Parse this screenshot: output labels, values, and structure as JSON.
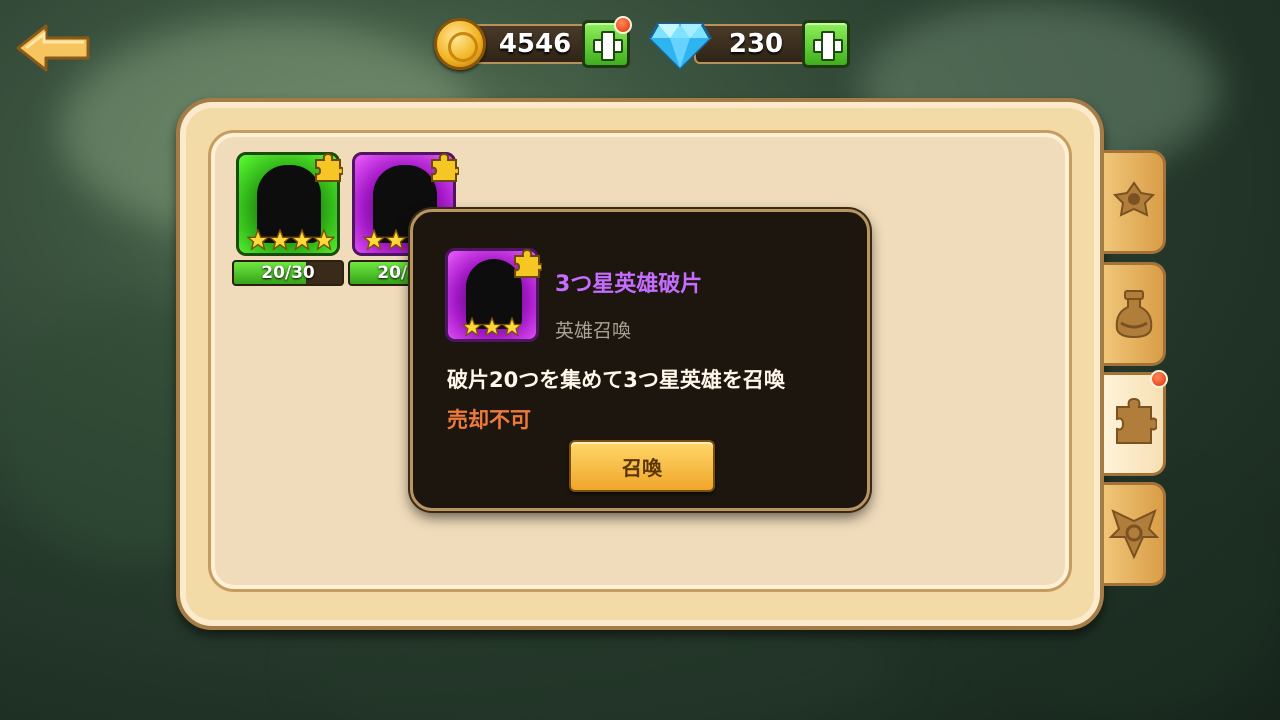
{
  "currency": {
    "coins": "4546",
    "gems": "230"
  },
  "heroes": [
    {
      "rarity_color": "#2fb016",
      "stars": 4,
      "progress": "20/30",
      "fill": 0.667
    },
    {
      "rarity_color": "#a218c6",
      "stars": 3,
      "progress": "20/20",
      "fill": 1.0
    }
  ],
  "popup": {
    "title": "3つ星英雄破片",
    "subtitle": "英雄召喚",
    "description": "破片20つを集めて3つ星英雄を召喚",
    "warning": "売却不可",
    "summon_button": "召喚",
    "stars": 3
  },
  "side_tabs": [
    {
      "icon": "helmet-icon",
      "active": false
    },
    {
      "icon": "potion-icon",
      "active": false
    },
    {
      "icon": "puzzle-icon",
      "active": true,
      "notification": true
    },
    {
      "icon": "emblem-icon",
      "active": false
    }
  ],
  "colors": {
    "panel": "#f3dba8",
    "popup_bg": "#1d160f",
    "title_purple": "#c66cff",
    "warning_orange": "#ef7b3b",
    "progress_green": "#35a31a"
  }
}
